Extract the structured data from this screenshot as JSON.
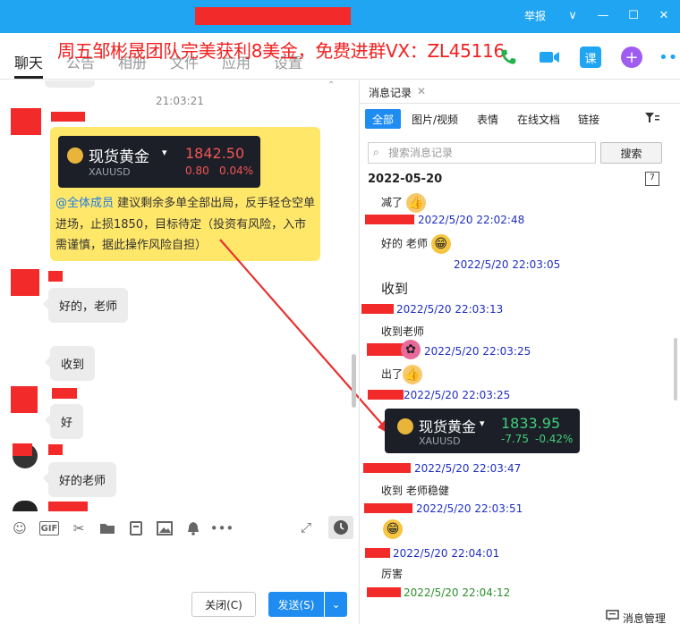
{
  "window": {
    "report_label": "举报",
    "controls": [
      "∨",
      "—",
      "☐",
      "✕"
    ]
  },
  "tabs": [
    {
      "label": "聊天",
      "active": true
    },
    {
      "label": "公告"
    },
    {
      "label": "相册"
    },
    {
      "label": "文件"
    },
    {
      "label": "应用"
    },
    {
      "label": "设置"
    }
  ],
  "banner": "周五邹彬晟团队完美获利8美金，免费进群VX：ZL45116",
  "chat": {
    "timestamp": "21:03:21",
    "card": {
      "gold_name": "现货黄金",
      "gold_code": "XAUUSD",
      "price": "1842.50",
      "change": "0.80",
      "change_pct": "0.04%",
      "mention": "@全体成员",
      "text": " 建议剩余多单全部出局，反手轻仓空单进场，止损1850，目标待定（投资有风险，入市需谨慎，据此操作风险自担）"
    },
    "messages": [
      "好的，老师",
      "收到",
      "好",
      "好的老师"
    ]
  },
  "toolbar": {
    "gif_label": "GIF"
  },
  "buttons": {
    "close": "关闭(C)",
    "send": "发送(S)"
  },
  "history": {
    "title": "消息记录",
    "close": "✕",
    "filters": [
      "全部",
      "图片/视频",
      "表情",
      "在线文档",
      "链接"
    ],
    "search_placeholder": "搜索消息记录",
    "search_button": "搜索",
    "date": "2022-05-20",
    "calendar_day": "7",
    "entries": [
      {
        "msg": "减了"
      },
      {
        "time": "2022/5/20 22:02:48"
      },
      {
        "msg": "好的 老师"
      },
      {
        "time": "2022/5/20 22:03:05"
      },
      {
        "msg": "收到"
      },
      {
        "time": "2022/5/20 22:03:13"
      },
      {
        "msg": "收到老师"
      },
      {
        "time": "2022/5/20 22:03:25"
      },
      {
        "msg": "出了"
      },
      {
        "time": "2022/5/20 22:03:25"
      },
      {
        "time": "2022/5/20 22:03:47"
      },
      {
        "msg": "收到 老师稳健"
      },
      {
        "time": "2022/5/20 22:03:51"
      },
      {
        "time": "2022/5/20 22:04:01"
      },
      {
        "msg": "厉害"
      },
      {
        "time": "2022/5/20 22:04:12"
      }
    ],
    "card": {
      "gold_name": "现货黄金",
      "gold_code": "XAUUSD",
      "price": "1833.95",
      "change": "-7.75",
      "change_pct": "-0.42%"
    },
    "manage": "消息管理"
  },
  "colors": {
    "titlebar": "#1fa5f2",
    "banner": "#f21f1f",
    "redact": "#f22a2a",
    "accent": "#1e8cf0",
    "timestamp": "#1f2fc4",
    "timestamp_green": "#2d8f2d",
    "card_bg": "#ffe76a"
  },
  "icons": [
    "smile-icon",
    "gif-icon",
    "scissors-icon",
    "folder-icon",
    "document-icon",
    "image-icon",
    "bell-icon",
    "more-icon",
    "expand-icon",
    "clock-icon",
    "phone-icon",
    "video-icon",
    "lesson-icon",
    "add-app-icon",
    "menu-dots-icon",
    "filter-icon",
    "calendar-icon",
    "search-icon"
  ]
}
